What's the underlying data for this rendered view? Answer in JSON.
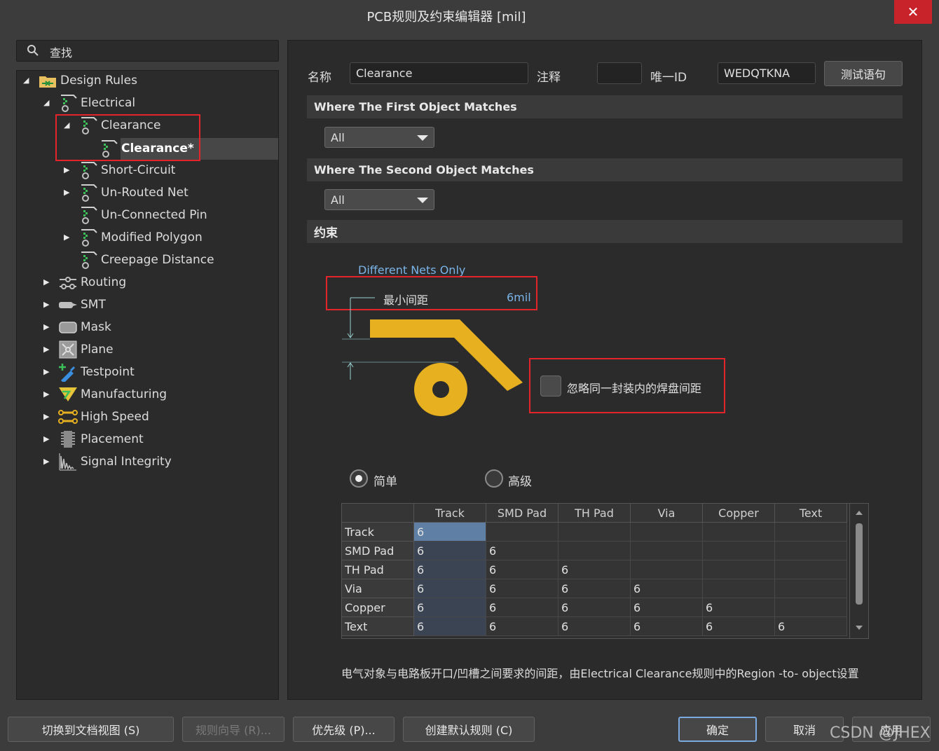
{
  "window": {
    "title": "PCB规则及约束编辑器 [mil]",
    "close_glyph": "✕"
  },
  "search": {
    "label": "查找"
  },
  "tree": {
    "root": "Design Rules",
    "electrical": "Electrical",
    "clearance": "Clearance",
    "clearance_rule": "Clearance*",
    "items": {
      "short_circuit": "Short-Circuit",
      "unrouted_net": "Un-Routed Net",
      "unconnected_pin": "Un-Connected Pin",
      "modified_polygon": "Modified Polygon",
      "creepage": "Creepage Distance",
      "routing": "Routing",
      "smt": "SMT",
      "mask": "Mask",
      "plane": "Plane",
      "testpoint": "Testpoint",
      "manufacturing": "Manufacturing",
      "high_speed": "High Speed",
      "placement": "Placement",
      "signal_integrity": "Signal Integrity"
    }
  },
  "form": {
    "name_label": "名称",
    "name_value": "Clearance",
    "comment_label": "注释",
    "comment_value": "",
    "uid_label": "唯一ID",
    "uid_value": "WEDQTKNA",
    "test_button": "测试语句"
  },
  "first_match": {
    "title": "Where The First Object Matches",
    "value": "All"
  },
  "second_match": {
    "title": "Where The Second Object Matches",
    "value": "All"
  },
  "constraints": {
    "title": "约束",
    "net_scope": "Different Nets Only",
    "min_clearance_label": "最小间距",
    "min_clearance_value": "6mil",
    "ignore_pads_label": "忽略同一封装内的焊盘间距",
    "ignore_pads_checked": false,
    "mode_simple": "简单",
    "mode_advanced": "高级",
    "mode_selected": "简单"
  },
  "clearance_table": {
    "columns": [
      "Track",
      "SMD Pad",
      "TH Pad",
      "Via",
      "Copper",
      "Text"
    ],
    "rows": [
      {
        "name": "Track",
        "values": [
          "6",
          "",
          "",
          "",
          "",
          ""
        ]
      },
      {
        "name": "SMD Pad",
        "values": [
          "6",
          "6",
          "",
          "",
          "",
          ""
        ]
      },
      {
        "name": "TH Pad",
        "values": [
          "6",
          "6",
          "6",
          "",
          "",
          ""
        ]
      },
      {
        "name": "Via",
        "values": [
          "6",
          "6",
          "6",
          "6",
          "",
          ""
        ]
      },
      {
        "name": "Copper",
        "values": [
          "6",
          "6",
          "6",
          "6",
          "6",
          ""
        ]
      },
      {
        "name": "Text",
        "values": [
          "6",
          "6",
          "6",
          "6",
          "6",
          "6"
        ]
      }
    ]
  },
  "description": "电气对象与电路板开口/凹槽之间要求的间距，由Electrical Clearance规则中的Region -to- object设置",
  "buttons": {
    "switch_doc": "切换到文档视图 (S)",
    "wizard": "规则向导 (R)...",
    "priority": "优先级 (P)...",
    "create_default": "创建默认规则 (C)",
    "ok": "确定",
    "cancel": "取消",
    "apply": "应用"
  },
  "watermark": "CSDN @JHEX",
  "colors": {
    "accent_red": "#e3242b",
    "copper": "#e6b020",
    "link_blue": "#7ab4e8",
    "selection": "#5f7fa5"
  }
}
